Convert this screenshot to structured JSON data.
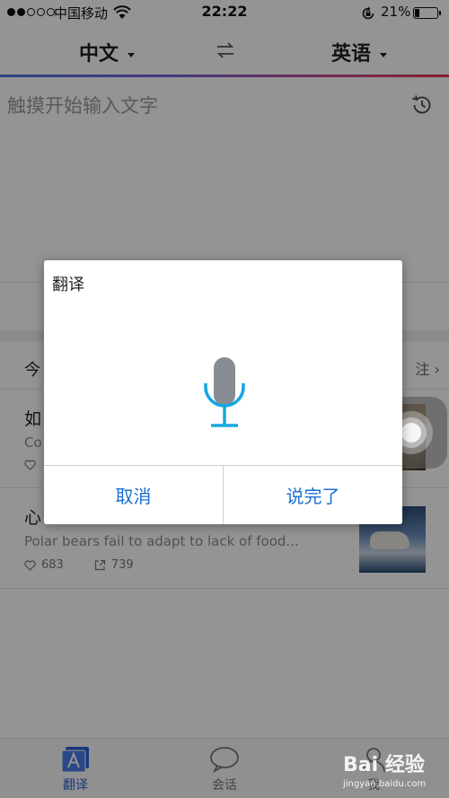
{
  "status_bar": {
    "carrier": "中国移动",
    "time": "22:22",
    "battery": "21%"
  },
  "lang_bar": {
    "source": "中文",
    "target": "英语"
  },
  "input": {
    "placeholder": "触摸开始输入文字"
  },
  "feed": {
    "header_title": "今",
    "header_more": "注",
    "items": [
      {
        "title": "如",
        "subtitle": "Co",
        "likes": "",
        "shares": ""
      },
      {
        "title": "心",
        "subtitle": "Polar bears fail to adapt to lack of food...",
        "likes": "683",
        "shares": "739"
      }
    ]
  },
  "tab_bar": {
    "tabs": [
      {
        "label": "翻译",
        "icon": "translate-icon",
        "active": true
      },
      {
        "label": "会话",
        "icon": "chat-bubble-icon",
        "active": false
      },
      {
        "label": "我",
        "icon": "profile-icon",
        "active": false
      }
    ]
  },
  "dialog": {
    "title": "翻译",
    "cancel_label": "取消",
    "done_label": "说完了",
    "mic_color": "#14a7e0"
  },
  "watermark": {
    "logo": "Bai 经验",
    "sub": "jingyan.baidu.com"
  },
  "colors": {
    "accent": "#1a6fd0",
    "active_tab": "#2c5fd6"
  }
}
